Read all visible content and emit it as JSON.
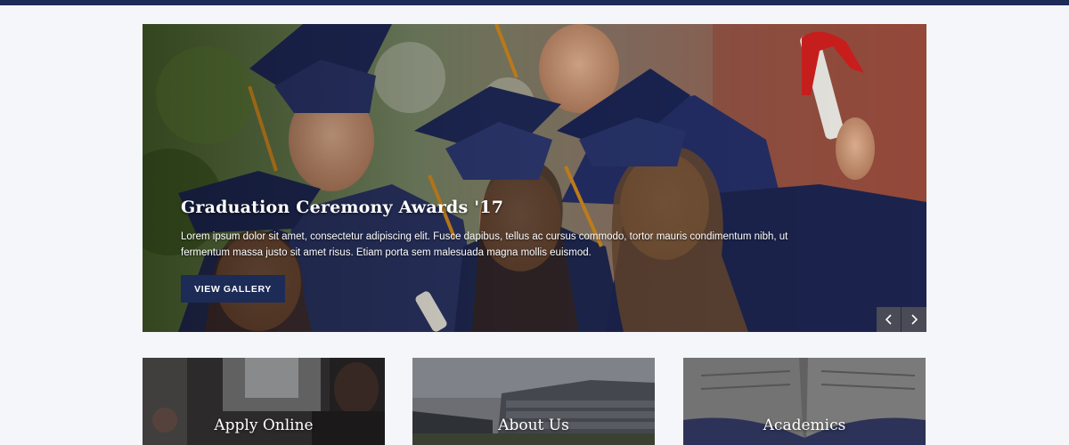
{
  "hero": {
    "title": "Graduation Ceremony Awards '17",
    "text": "Lorem ipsum dolor sit amet, consectetur adipiscing elit. Fusce dapibus, tellus ac cursus commodo, tortor mauris condimentum nibh, ut fermentum massa justo sit amet risus. Etiam porta sem malesuada magna mollis euismod.",
    "button_label": "VIEW GALLERY",
    "prev_icon": "chevron-left-icon",
    "next_icon": "chevron-right-icon"
  },
  "cards": [
    {
      "title": "Apply Online"
    },
    {
      "title": "About Us"
    },
    {
      "title": "Academics"
    }
  ],
  "colors": {
    "brand_navy": "#1d2b57",
    "page_bg": "#f4f6f9"
  }
}
